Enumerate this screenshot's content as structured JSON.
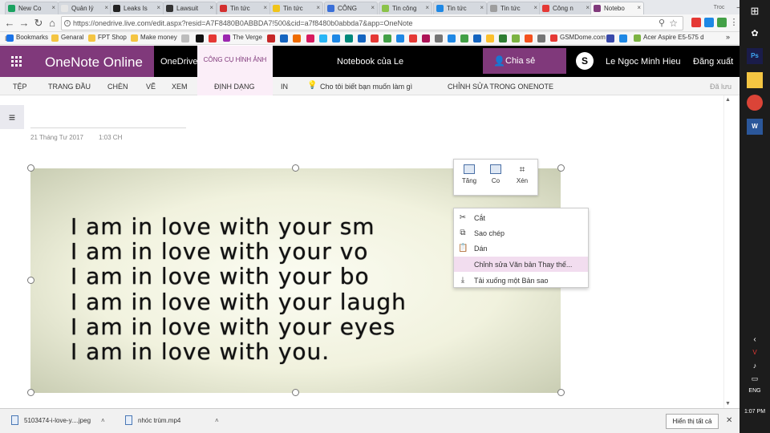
{
  "tabs": [
    {
      "title": "New Co",
      "color": "#1aa260"
    },
    {
      "title": "Quản lý",
      "color": "#e6e6e6"
    },
    {
      "title": "Leaks Is",
      "color": "#222222"
    },
    {
      "title": "Lawsuit",
      "color": "#333333"
    },
    {
      "title": "Tin tức",
      "color": "#d32f2f"
    },
    {
      "title": "Tin tức",
      "color": "#f0c419"
    },
    {
      "title": "CÔNG",
      "color": "#3a6fd8"
    },
    {
      "title": "Tin công",
      "color": "#8bc34a"
    },
    {
      "title": "Tin tức",
      "color": "#1e88e5"
    },
    {
      "title": "Tin tức",
      "color": "#9e9e9e"
    },
    {
      "title": "Công n",
      "color": "#e53935"
    },
    {
      "title": "Notebo",
      "color": "#80397b"
    }
  ],
  "window_badge": "Troc",
  "address": {
    "url": "https://onedrive.live.com/edit.aspx?resid=A7F8480B0ABBDA7!500&cid=a7f8480b0abbda7&app=OneNote"
  },
  "bookmarks": [
    {
      "label": "Bookmarks",
      "color": "#1a73e8"
    },
    {
      "label": "Genaral",
      "color": "#f4c542"
    },
    {
      "label": "FPT Shop",
      "color": "#f4c542"
    },
    {
      "label": "Make money",
      "color": "#f4c542"
    },
    {
      "label": "The Verge",
      "color": "#9c27b0"
    },
    {
      "label": "GSMDome.com",
      "color": "#e53935"
    },
    {
      "label": "Acer Aspire E5-575 d",
      "color": "#7cb342"
    }
  ],
  "header": {
    "app_name": "OneNote Online",
    "onedrive": "OneDrive",
    "context_tab": "CÔNG CỤ HÌNH ẢNH",
    "notebook": "Notebook của Le",
    "share": "Chia sẻ",
    "username": "Le Ngoc Minh Hieu",
    "signout": "Đăng xuất"
  },
  "ribbon": {
    "file": "TỆP",
    "home": "TRANG ĐẦU",
    "insert": "CHÈN",
    "draw": "VẼ",
    "view": "XEM",
    "format": "ĐỊNH DẠNG",
    "print": "IN",
    "tell_me": "Cho tôi biết bạn muốn làm gì",
    "edit_in_onenote": "CHỈNH SỬA TRONG ONENOTE",
    "saved": "Đã lưu"
  },
  "page": {
    "date": "21 Tháng Tư 2017",
    "time": "1:03 CH"
  },
  "image_text": [
    "I am in love with your sm",
    "I am in love with your vo",
    "I am in love with your bo",
    "I am in love with your laugh",
    "I am in love with your eyes",
    "I am in love with you."
  ],
  "image_tools": {
    "grow": "Tăng",
    "shrink": "Co",
    "crop": "Xén"
  },
  "context_menu": {
    "cut": "Cắt",
    "copy": "Sao chép",
    "paste": "Dán",
    "alt_text": "Chỉnh sửa Văn bản Thay thế...",
    "download": "Tải xuống một Bản sao"
  },
  "downloads": {
    "file1": "5103474-i-love-y....jpeg",
    "file2": "nhóc trùm.mp4",
    "show_all": "Hiển thị tất cả"
  },
  "taskbar": {
    "lang": "ENG",
    "time": "1:07 PM"
  }
}
